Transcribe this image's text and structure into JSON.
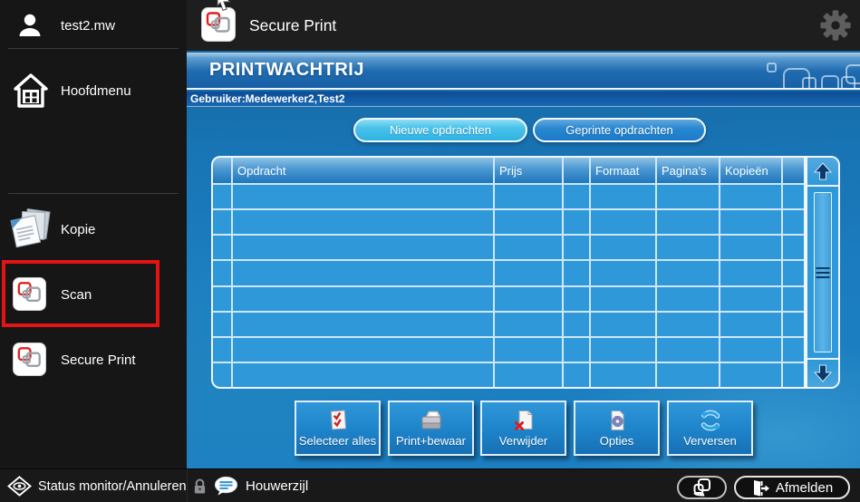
{
  "header": {
    "title": "Secure Print"
  },
  "sidebar": {
    "user_label": "test2.mw",
    "items": [
      {
        "label": "Hoofdmenu"
      },
      {
        "label": "Kopie"
      },
      {
        "label": "Scan"
      },
      {
        "label": "Secure Print"
      }
    ]
  },
  "queue": {
    "title": "PRINTWACHTRIJ",
    "user_line": "Gebruiker:Medewerker2,Test2",
    "tabs": [
      {
        "label": "Nieuwe opdrachten",
        "active": true
      },
      {
        "label": "Geprinte opdrachten",
        "active": false
      }
    ],
    "table": {
      "columns": [
        "",
        "Opdracht",
        "Prijs",
        "",
        "Formaat",
        "Pagina's",
        "Kopieën",
        ""
      ],
      "rows": [],
      "row_count_visible": 8
    },
    "actions": [
      {
        "label": "Selecteer alles",
        "icon": "select-all-icon"
      },
      {
        "label": "Print+bewaar",
        "icon": "printer-icon"
      },
      {
        "label": "Verwijder",
        "icon": "delete-icon"
      },
      {
        "label": "Opties",
        "icon": "options-icon"
      },
      {
        "label": "Verversen",
        "icon": "refresh-icon"
      }
    ]
  },
  "footer": {
    "status_label": "Status monitor/Annuleren",
    "device_name": "Houwerzijl",
    "logout_label": "Afmelden"
  },
  "colors": {
    "active_tab_cyan": "#45c0ea",
    "inactive_tab_blue": "#1f86cf",
    "table_cell_blue": "#2e98d9",
    "main_background_blue": "#1b7dc0",
    "highlight_red": "#e31414",
    "action_button_blue": "#1f85cb",
    "dark_chrome": "#1e1e1e"
  }
}
